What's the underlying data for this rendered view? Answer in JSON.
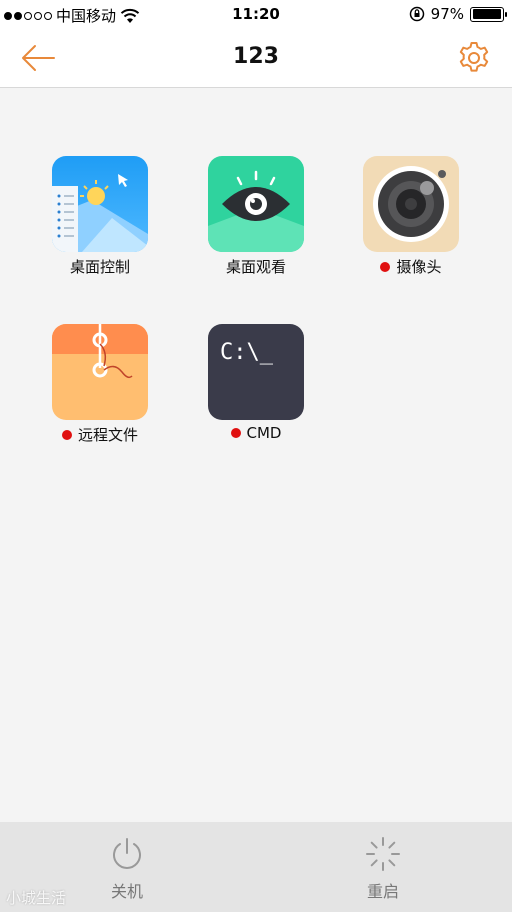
{
  "status_bar": {
    "carrier": "中国移动",
    "time": "11:20",
    "battery_percent": "97%",
    "battery_level": 0.97,
    "signal_filled": 2,
    "signal_total": 5
  },
  "nav": {
    "title": "123",
    "back_icon": "arrow-left-icon",
    "settings_icon": "gear-icon",
    "accent_color": "#e8893a"
  },
  "apps": [
    {
      "label": "桌面控制",
      "icon": "desktop-control-icon",
      "indicator": false
    },
    {
      "label": "桌面观看",
      "icon": "eye-icon",
      "indicator": false
    },
    {
      "label": "摄像头",
      "icon": "camera-icon",
      "indicator": true
    },
    {
      "label": "远程文件",
      "icon": "file-envelope-icon",
      "indicator": true
    },
    {
      "label": "CMD",
      "icon": "terminal-icon",
      "indicator": true,
      "icon_text": "C:\\_"
    }
  ],
  "bottom_bar": {
    "shutdown_label": "关机",
    "restart_label": "重启"
  },
  "watermark": "小城生活",
  "colors": {
    "indicator_red": "#e01010",
    "cmd_bg": "#3a3b4a"
  }
}
